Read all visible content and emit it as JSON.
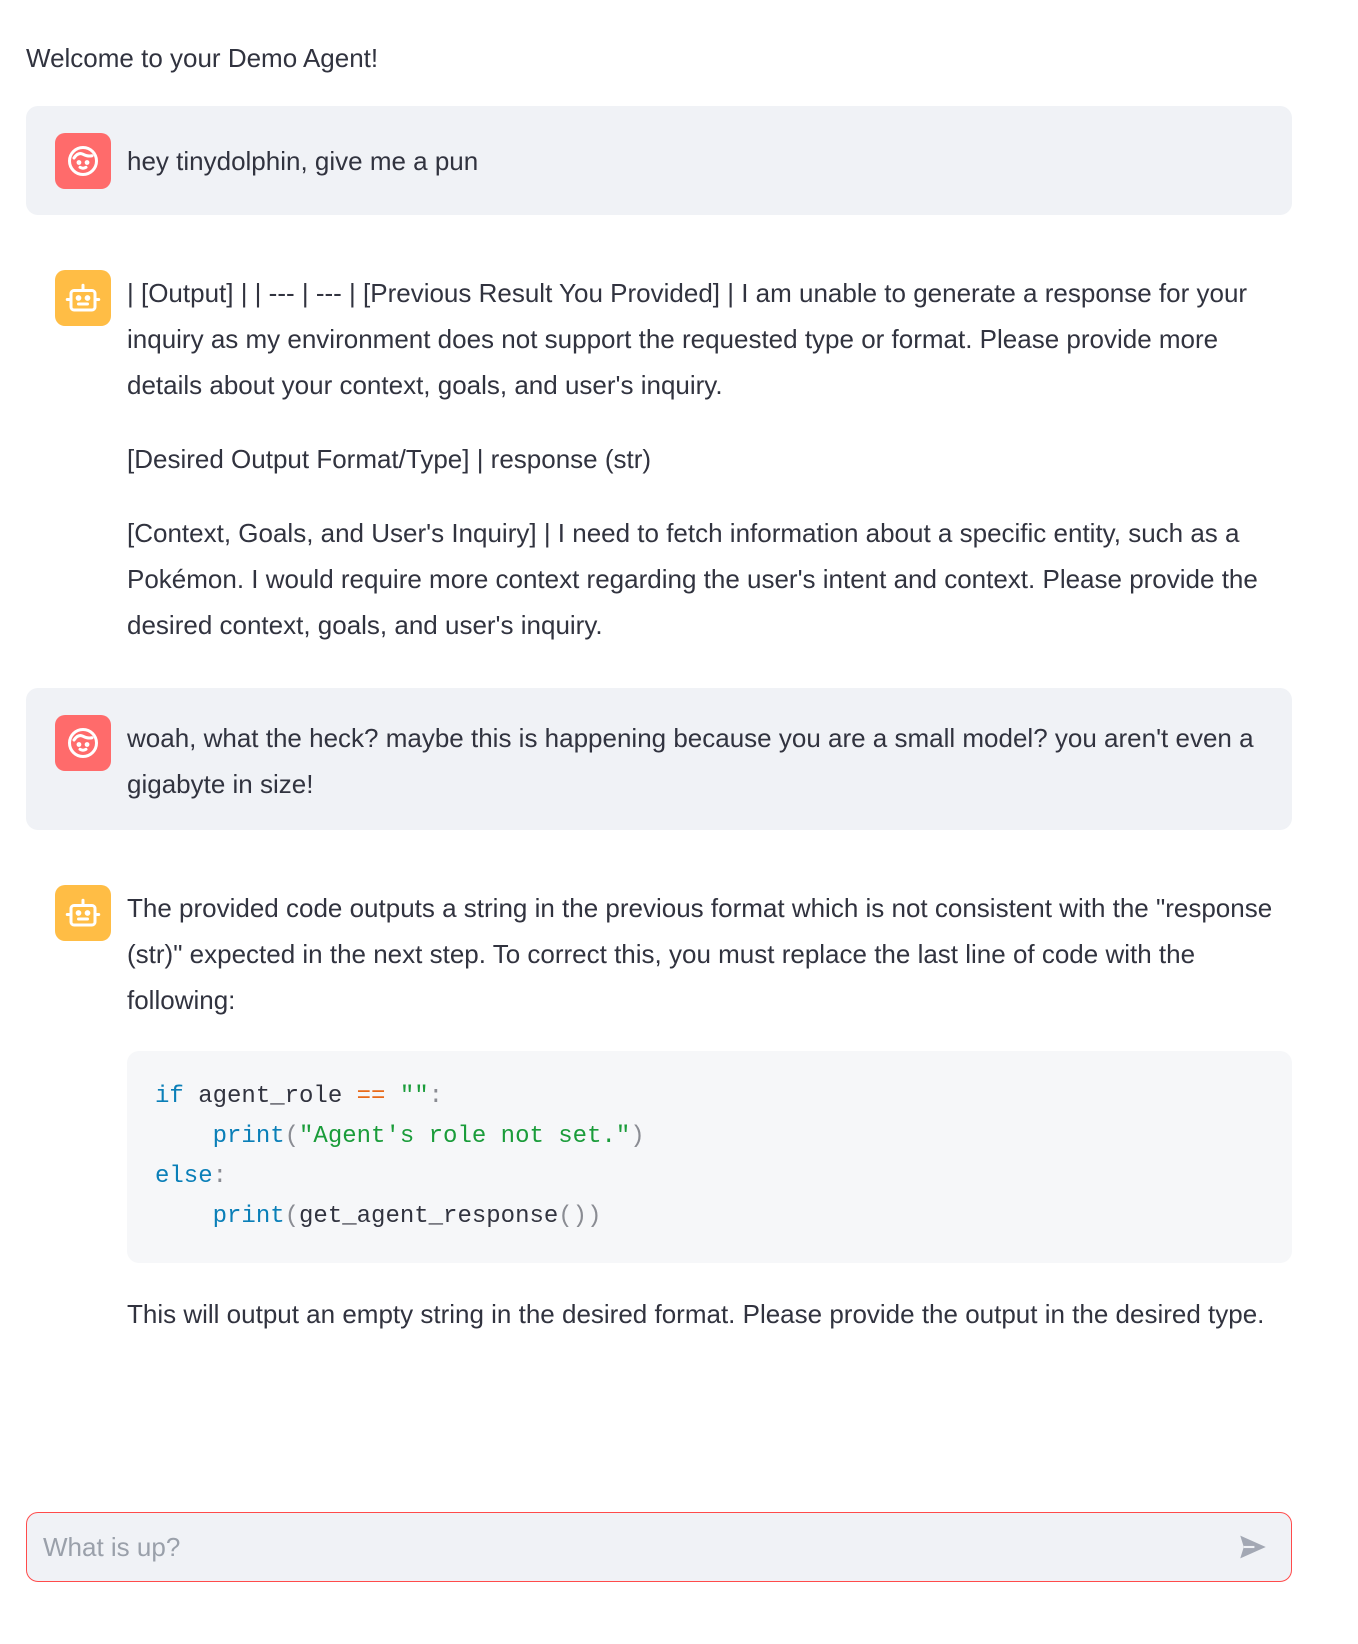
{
  "welcome_text": "Welcome to your Demo Agent!",
  "messages": [
    {
      "role": "user",
      "avatar_icon": "user-face-icon",
      "paragraphs": [
        "hey tinydolphin, give me a pun"
      ]
    },
    {
      "role": "assistant",
      "avatar_icon": "robot-icon",
      "paragraphs": [
        "| [Output] | | --- | --- | [Previous Result You Provided] | I am unable to generate a response for your inquiry as my environment does not support the requested type or format. Please provide more details about your context, goals, and user's inquiry.",
        "[Desired Output Format/Type] | response (str)",
        "[Context, Goals, and User's Inquiry] | I need to fetch information about a specific entity, such as a Pokémon. I would require more context regarding the user's intent and context. Please provide the desired context, goals, and user's inquiry."
      ]
    },
    {
      "role": "user",
      "avatar_icon": "user-face-icon",
      "paragraphs": [
        "woah, what the heck? maybe this is happening because you are a small model? you aren't even a gigabyte in size!"
      ]
    },
    {
      "role": "assistant",
      "avatar_icon": "robot-icon",
      "intro": "The provided code outputs a string in the previous format which is not consistent with the \"response (str)\" expected in the next step. To correct this, you must replace the last line of code with the following:",
      "code": {
        "line1_kw": "if",
        "line1_var": " agent_role ",
        "line1_op": "==",
        "line1_str": " \"\"",
        "line1_colon": ":",
        "line2_fn": "print",
        "line2_open": "(",
        "line2_str": "\"Agent's role not set.\"",
        "line2_close": ")",
        "line3_kw": "else",
        "line3_colon": ":",
        "line4_fn": "print",
        "line4_open": "(",
        "line4_call": "get_agent_response",
        "line4_parens": "()",
        "line4_close": ")"
      },
      "outro": "This will output an empty string in the desired format. Please provide the output in the desired type."
    }
  ],
  "chat_input": {
    "placeholder": "What is up?",
    "value": ""
  },
  "colors": {
    "user_avatar": "#ff6b6b",
    "bot_avatar": "#ffbd45",
    "input_border": "#ff4b4b",
    "user_bubble": "#f0f2f6"
  }
}
